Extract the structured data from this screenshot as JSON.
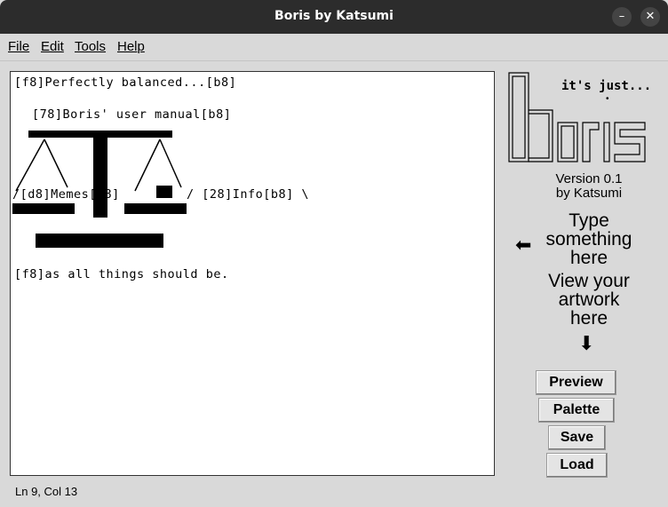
{
  "window": {
    "title": "Boris by Katsumi"
  },
  "menu": {
    "file": "File",
    "edit": "Edit",
    "tools": "Tools",
    "help": "Help"
  },
  "editor": {
    "line1": "[f8]Perfectly balanced...[b8]",
    "line2": "[78]Boris' user manual[b8]",
    "line3_left": "/[d8]Memes[b8]",
    "line3_right": "/ [28]Info[b8] \\",
    "line4": "[f8]as all things should be."
  },
  "logo": {
    "tagline": "it's just...",
    "dot": "•"
  },
  "info": {
    "version": "Version 0.1",
    "author": "by Katsumi"
  },
  "hints": {
    "type": [
      "Type",
      "something",
      "here"
    ],
    "view": [
      "View your",
      "artwork",
      "here"
    ],
    "left_arrow": "⬅",
    "down_arrow": "⬇"
  },
  "buttons": {
    "preview": "Preview",
    "palette": "Palette",
    "save": "Save",
    "load": "Load"
  },
  "status": {
    "position": "Ln 9, Col 13"
  }
}
